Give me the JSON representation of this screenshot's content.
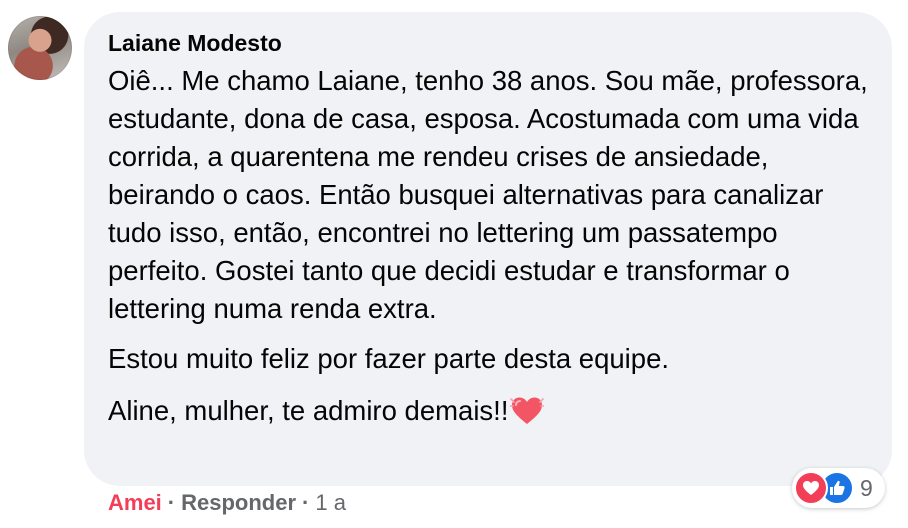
{
  "comment": {
    "author": "Laiane Modesto",
    "paragraphs": [
      "Oiê... Me chamo Laiane, tenho 38 anos. Sou mãe, professora, estudante, dona de casa, esposa. Acostumada com uma vida corrida, a quarentena me rendeu crises de ansiedade, beirando o caos. Então busquei alternativas para canalizar tudo isso, então, encontrei no lettering um passatempo perfeito. Gostei tanto que decidi estudar e transformar o lettering numa renda extra.",
      "Estou muito feliz por fazer parte desta equipe.",
      "Aline, mulher, te admiro demais!!"
    ],
    "trailing_emoji": "heart-pulse-icon"
  },
  "reactions": {
    "icons": [
      "love-icon",
      "like-icon"
    ],
    "count": "9"
  },
  "actions": {
    "reaction_label": "Amei",
    "reply_label": "Responder",
    "separator": "·",
    "timestamp": "1 a"
  },
  "colors": {
    "bubble": "#f0f2f5",
    "love": "#f33e58",
    "like": "#1b74e4",
    "secondary_text": "#65676b",
    "primary_text": "#050505"
  }
}
